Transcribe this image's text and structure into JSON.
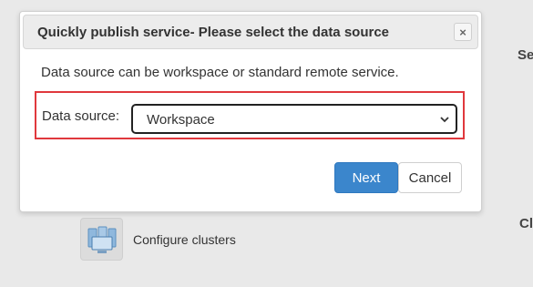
{
  "background": {
    "section_label_top": "Se",
    "section_label_bottom": "Cl",
    "configure_clusters_label": "Configure clusters"
  },
  "dialog": {
    "title": "Quickly publish service- Please select the data source",
    "close_glyph": "×",
    "description": "Data source can be workspace or standard remote service.",
    "data_source_label": "Data source:",
    "data_source_selected": "Workspace",
    "next_label": "Next",
    "cancel_label": "Cancel"
  },
  "colors": {
    "primary_button": "#3b86cc",
    "highlight_border": "#e0383d"
  }
}
